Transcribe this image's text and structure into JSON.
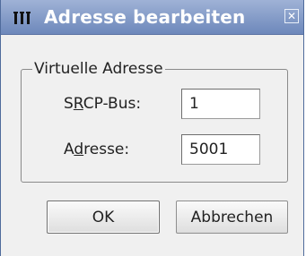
{
  "window": {
    "title": "Adresse bearbeiten",
    "app_icon": "app-menu-icon",
    "close_glyph": "✕"
  },
  "group": {
    "legend": "Virtuelle Adresse"
  },
  "fields": {
    "bus": {
      "label_pre": "S",
      "label_mnemonic": "R",
      "label_post": "CP-Bus:",
      "value": "1"
    },
    "address": {
      "label_pre": "A",
      "label_mnemonic": "d",
      "label_post": "resse:",
      "value": "5001"
    }
  },
  "buttons": {
    "ok": "OK",
    "cancel": "Abbrechen"
  },
  "colors": {
    "title_gradient_top": "#9fb2d6",
    "title_gradient_bottom": "#6d88bb",
    "dialog_background": "#f0f0f0"
  }
}
